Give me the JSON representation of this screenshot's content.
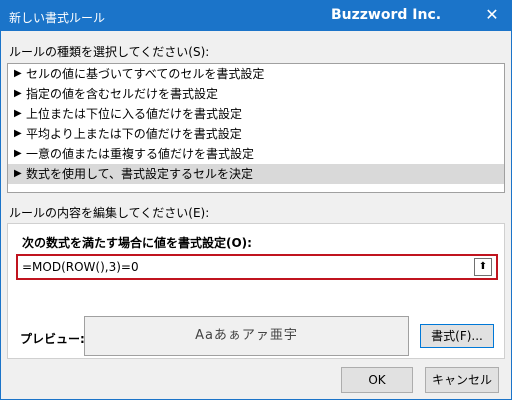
{
  "window": {
    "title": "新しい書式ルール",
    "brand": "Buzzword Inc.",
    "close_glyph": "✕"
  },
  "rule_type": {
    "label": "ルールの種類を選択してください(S):",
    "items": [
      {
        "label": "セルの値に基づいてすべてのセルを書式設定"
      },
      {
        "label": "指定の値を含むセルだけを書式設定"
      },
      {
        "label": "上位または下位に入る値だけを書式設定"
      },
      {
        "label": "平均より上または下の値だけを書式設定"
      },
      {
        "label": "一意の値または重複する値だけを書式設定"
      },
      {
        "label": "数式を使用して、書式設定するセルを決定"
      }
    ],
    "selected_index": 5,
    "arrow_glyph": "▶"
  },
  "rule_edit": {
    "label": "ルールの内容を編集してください(E):",
    "formula_label": "次の数式を満たす場合に値を書式設定(O):",
    "formula_value": "=MOD(ROW(),3)=0",
    "collapse_glyph": "⬆",
    "preview_label": "プレビュー:",
    "preview_text": "Aaあぁアァ亜宇",
    "format_button": "書式(F)..."
  },
  "buttons": {
    "ok": "OK",
    "cancel": "キャンセル"
  },
  "colors": {
    "titlebar": "#1b74c9",
    "formula_border": "#c0141f"
  }
}
